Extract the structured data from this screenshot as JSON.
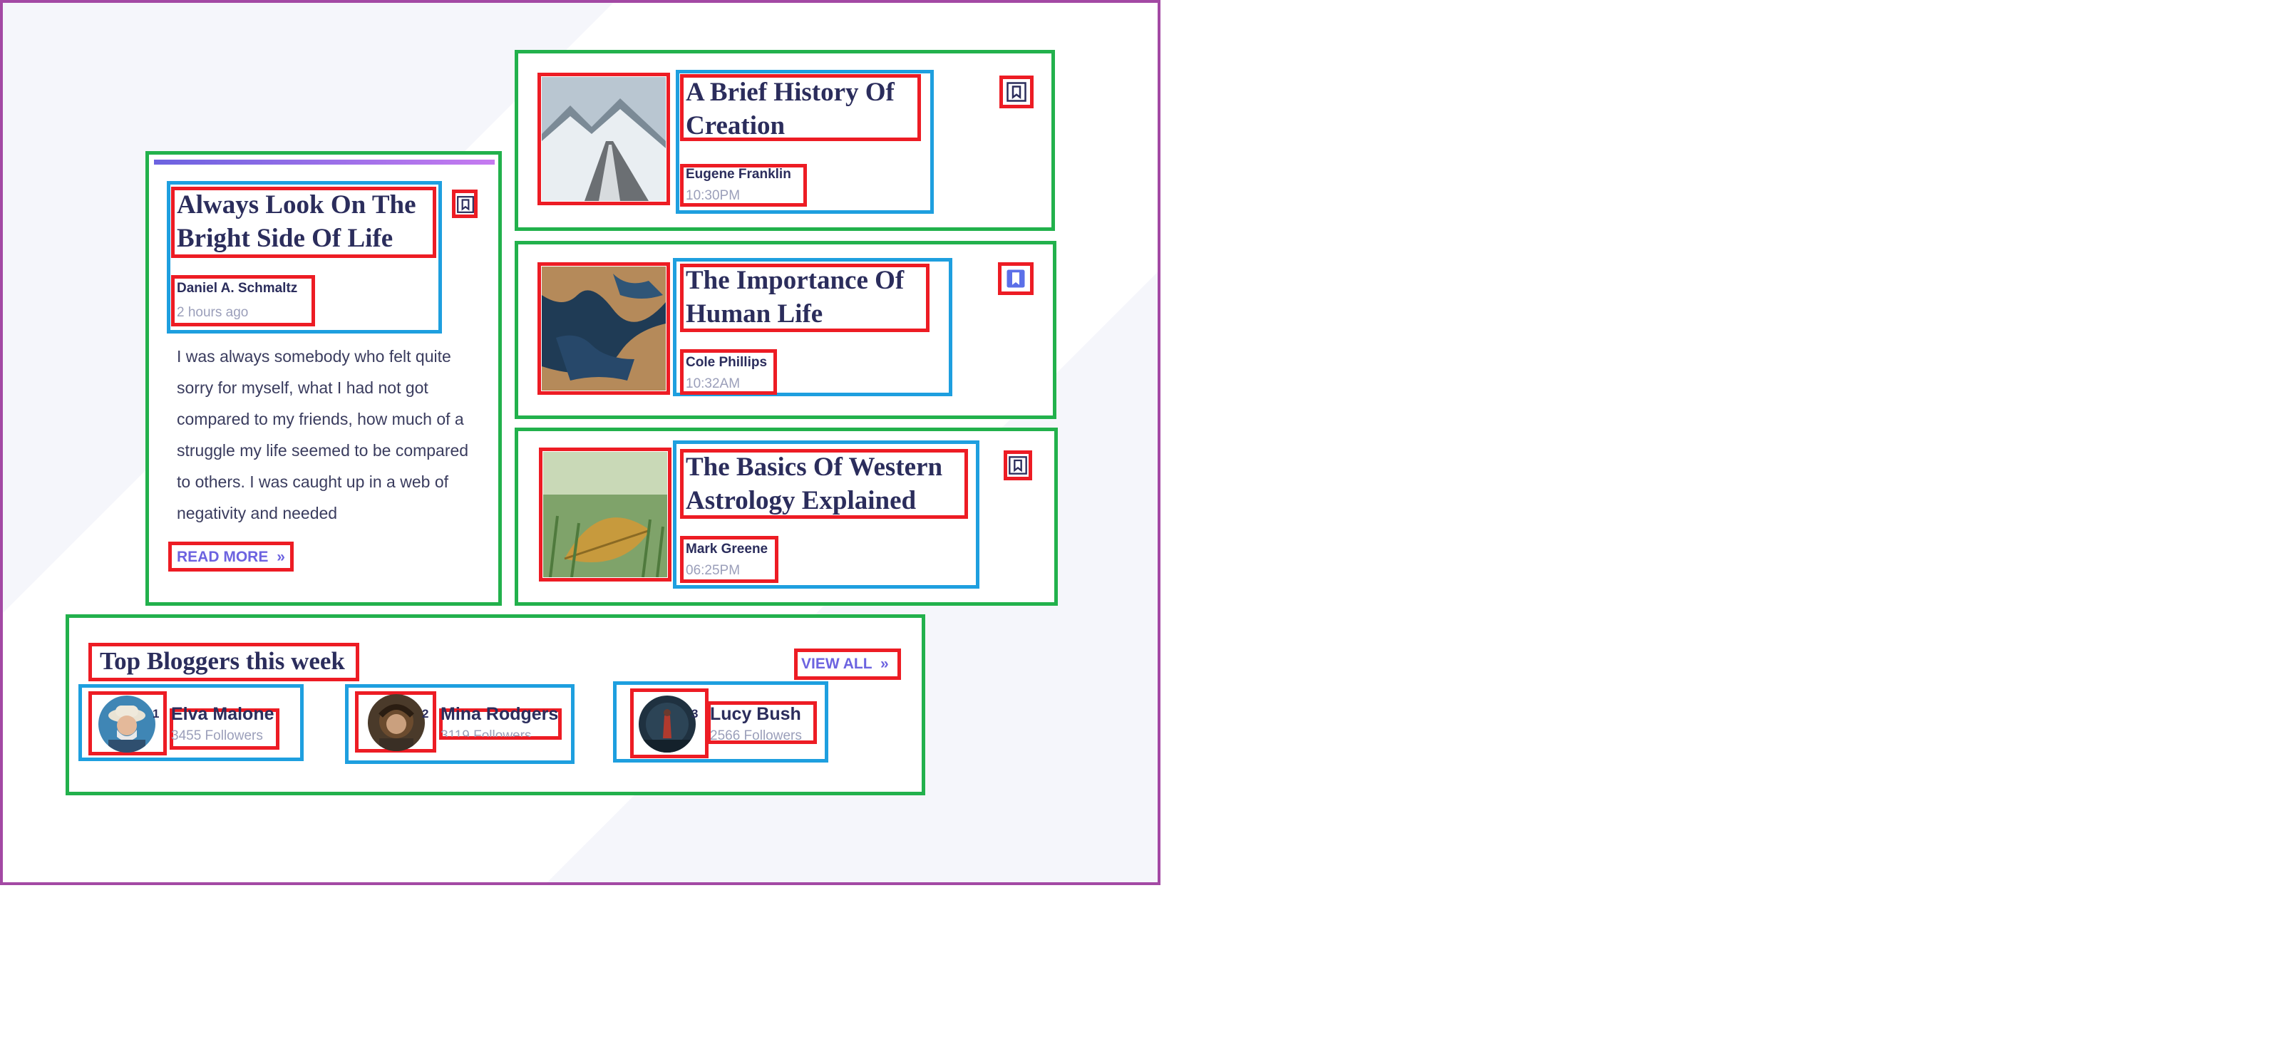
{
  "featured": {
    "title": "Always Look On The Bright Side Of Life",
    "author": "Daniel A. Schmaltz",
    "time": "2 hours ago",
    "excerpt": "I was always somebody who felt quite sorry for myself, what I had not got compared to my friends, how much of a struggle my life seemed to be compared to others. I was caught up in a web of negativity and needed",
    "read_more_label": "READ MORE",
    "bookmarked": false
  },
  "posts": [
    {
      "title": "A Brief History Of Creation",
      "author": "Eugene Franklin",
      "time": "10:30PM",
      "bookmarked": false,
      "image": "snowy-mountain-road"
    },
    {
      "title": "The Importance Of Human Life",
      "author": "Cole Phillips",
      "time": "10:32AM",
      "bookmarked": true,
      "image": "aerial-lake-desert"
    },
    {
      "title": "The Basics Of Western Astrology Explained",
      "author": "Mark Greene",
      "time": "06:25PM",
      "bookmarked": false,
      "image": "leaf-in-grass"
    }
  ],
  "bloggers_section": {
    "title": "Top Bloggers this week",
    "view_all_label": "VIEW ALL",
    "bloggers": [
      {
        "rank": "1",
        "name": "Elva Malone",
        "followers": "3455 Followers"
      },
      {
        "rank": "2",
        "name": "Mina Rodgers",
        "followers": "3119 Followers"
      },
      {
        "rank": "3",
        "name": "Lucy Bush",
        "followers": "2566 Followers"
      }
    ]
  },
  "colors": {
    "title": "#2b2d5c",
    "accent": "#6c63e0",
    "muted": "#9b9fba",
    "bookmark_active": "#5b6fe8"
  },
  "icons": {
    "bookmark": "bookmark-icon",
    "bookmark_filled": "bookmark-filled-icon",
    "read_more": "double-chevron-right-icon"
  }
}
